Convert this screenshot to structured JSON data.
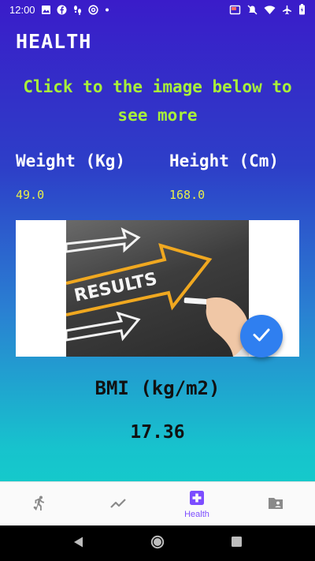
{
  "status_bar": {
    "time": "12:00"
  },
  "page": {
    "title": "HEALTH",
    "hint": "Click to the image below to see more"
  },
  "metrics": {
    "weight_label": "Weight (Kg)",
    "weight_value": "49.0",
    "height_label": "Height (Cm)",
    "height_value": "168.0"
  },
  "banner": {
    "image_text": "RESULTS"
  },
  "bmi": {
    "label": "BMI (kg/m2)",
    "value": "17.36"
  },
  "bottom_nav": {
    "items": [
      {
        "label": "",
        "icon": "run-icon"
      },
      {
        "label": "",
        "icon": "trending-icon"
      },
      {
        "label": "Health",
        "icon": "medical-plus-icon"
      },
      {
        "label": "",
        "icon": "contact-folder-icon"
      }
    ],
    "active_index": 2,
    "active_color": "#7c4dff",
    "inactive_color": "#8a8a8a"
  },
  "colors": {
    "hint": "#a8f03a",
    "values": "#e9ef4a",
    "fab": "#2f7ff0"
  }
}
